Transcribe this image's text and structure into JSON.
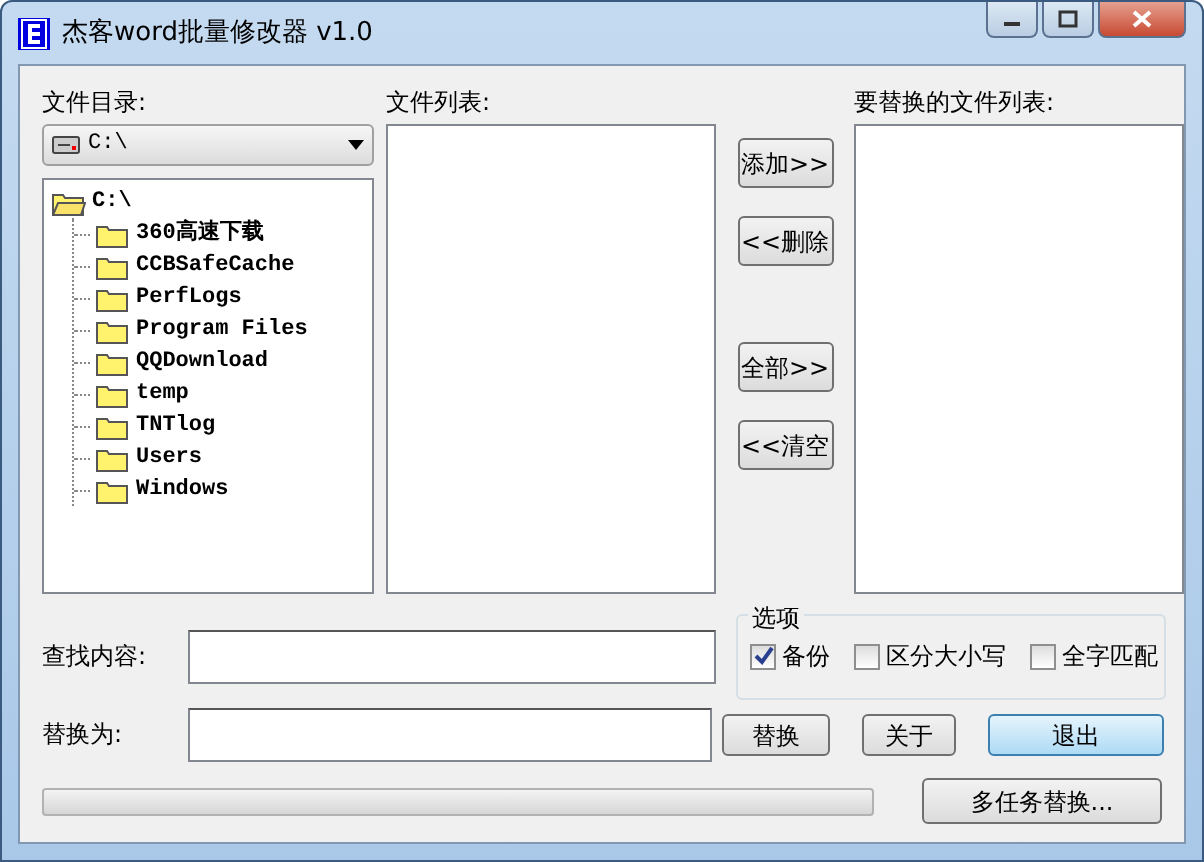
{
  "window": {
    "title": "杰客word批量修改器 v1.0"
  },
  "directory": {
    "label": "文件目录:",
    "drive": "C:\\",
    "tree": {
      "label": "C:\\",
      "expanded": true,
      "children": [
        {
          "label": "360高速下载"
        },
        {
          "label": "CCBSafeCache"
        },
        {
          "label": "PerfLogs"
        },
        {
          "label": "Program Files"
        },
        {
          "label": "QQDownload"
        },
        {
          "label": "temp"
        },
        {
          "label": "TNTlog"
        },
        {
          "label": "Users"
        },
        {
          "label": "Windows"
        }
      ]
    }
  },
  "file_list": {
    "label": "文件列表:"
  },
  "transfer_buttons": [
    "添加>>",
    "<<删除",
    "全部>>",
    "<<清空"
  ],
  "target_list": {
    "label": "要替换的文件列表:"
  },
  "find": {
    "label": "查找内容:"
  },
  "replace": {
    "label": "替换为:"
  },
  "options": {
    "title": "选项",
    "items": [
      {
        "label": "备份",
        "checked": true
      },
      {
        "label": "区分大小写",
        "checked": false
      },
      {
        "label": "全字匹配",
        "checked": false
      }
    ]
  },
  "action_buttons": [
    {
      "label": "替换",
      "default": false
    },
    {
      "label": "关于",
      "default": false
    },
    {
      "label": "退出",
      "default": true
    }
  ],
  "progress": {
    "level": 0
  },
  "multi_button": "多任务替换..."
}
